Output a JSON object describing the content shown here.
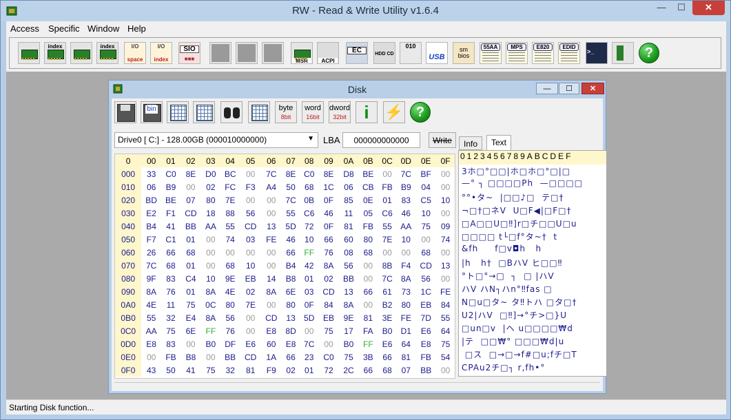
{
  "app": {
    "title": "RW - Read & Write Utility v1.6.4",
    "min_label": "—",
    "max_label": "☐",
    "close_label": "✕"
  },
  "menu": [
    "Access",
    "Specific",
    "Window",
    "Help"
  ],
  "toolbar": {
    "labels": {
      "index1": "index",
      "index2": "index",
      "space": "space",
      "index3": "index",
      "sio": "SIO",
      "msr": "MSR",
      "acpi": "ACPI",
      "ec": "EC",
      "hddcd": "HDD CD",
      "o10": "010",
      "usb": "USB",
      "smbios": "sm bios",
      "aa55": "55AA",
      "mps": "MPS",
      "e820": "E820",
      "edid": "EDID",
      "help": "?"
    }
  },
  "status": "Starting Disk function...",
  "disk": {
    "title": "Disk",
    "tools": {
      "byte_top": "byte",
      "byte_bot": "8",
      "byte_unit": "bit",
      "word_top": "word",
      "word_bot": "16",
      "word_unit": "bit",
      "dword_top": "dword",
      "dword_bot": "32",
      "dword_unit": "bit",
      "info_glyph": "i",
      "help_glyph": "?"
    },
    "drive_select": "Drive0 [ C:] - 128.00GB (000010000000)",
    "lba_label": "LBA",
    "lba_value": "000000000000",
    "write_button": "Write",
    "tabs": [
      "Info",
      "Text"
    ],
    "active_tab": "Text",
    "hex_header": [
      "0",
      "00",
      "01",
      "02",
      "03",
      "04",
      "05",
      "06",
      "07",
      "08",
      "09",
      "0A",
      "0B",
      "0C",
      "0D",
      "0E",
      "0F"
    ],
    "hex_rows": [
      [
        "000",
        "33",
        "C0",
        "8E",
        "D0",
        "BC",
        "00",
        "7C",
        "8E",
        "C0",
        "8E",
        "D8",
        "BE",
        "00",
        "7C",
        "BF",
        "00"
      ],
      [
        "010",
        "06",
        "B9",
        "00",
        "02",
        "FC",
        "F3",
        "A4",
        "50",
        "68",
        "1C",
        "06",
        "CB",
        "FB",
        "B9",
        "04",
        "00"
      ],
      [
        "020",
        "BD",
        "BE",
        "07",
        "80",
        "7E",
        "00",
        "00",
        "7C",
        "0B",
        "0F",
        "85",
        "0E",
        "01",
        "83",
        "C5",
        "10"
      ],
      [
        "030",
        "E2",
        "F1",
        "CD",
        "18",
        "88",
        "56",
        "00",
        "55",
        "C6",
        "46",
        "11",
        "05",
        "C6",
        "46",
        "10",
        "00"
      ],
      [
        "040",
        "B4",
        "41",
        "BB",
        "AA",
        "55",
        "CD",
        "13",
        "5D",
        "72",
        "0F",
        "81",
        "FB",
        "55",
        "AA",
        "75",
        "09"
      ],
      [
        "050",
        "F7",
        "C1",
        "01",
        "00",
        "74",
        "03",
        "FE",
        "46",
        "10",
        "66",
        "60",
        "80",
        "7E",
        "10",
        "00",
        "74"
      ],
      [
        "060",
        "26",
        "66",
        "68",
        "00",
        "00",
        "00",
        "00",
        "66",
        "FF",
        "76",
        "08",
        "68",
        "00",
        "00",
        "68",
        "00"
      ],
      [
        "070",
        "7C",
        "68",
        "01",
        "00",
        "68",
        "10",
        "00",
        "B4",
        "42",
        "8A",
        "56",
        "00",
        "8B",
        "F4",
        "CD",
        "13"
      ],
      [
        "080",
        "9F",
        "83",
        "C4",
        "10",
        "9E",
        "EB",
        "14",
        "B8",
        "01",
        "02",
        "BB",
        "00",
        "7C",
        "8A",
        "56",
        "00"
      ],
      [
        "090",
        "8A",
        "76",
        "01",
        "8A",
        "4E",
        "02",
        "8A",
        "6E",
        "03",
        "CD",
        "13",
        "66",
        "61",
        "73",
        "1C",
        "FE"
      ],
      [
        "0A0",
        "4E",
        "11",
        "75",
        "0C",
        "80",
        "7E",
        "00",
        "80",
        "0F",
        "84",
        "8A",
        "00",
        "B2",
        "80",
        "EB",
        "84"
      ],
      [
        "0B0",
        "55",
        "32",
        "E4",
        "8A",
        "56",
        "00",
        "CD",
        "13",
        "5D",
        "EB",
        "9E",
        "81",
        "3E",
        "FE",
        "7D",
        "55"
      ],
      [
        "0C0",
        "AA",
        "75",
        "6E",
        "FF",
        "76",
        "00",
        "E8",
        "8D",
        "00",
        "75",
        "17",
        "FA",
        "B0",
        "D1",
        "E6",
        "64"
      ],
      [
        "0D0",
        "E8",
        "83",
        "00",
        "B0",
        "DF",
        "E6",
        "60",
        "E8",
        "7C",
        "00",
        "B0",
        "FF",
        "E6",
        "64",
        "E8",
        "75"
      ],
      [
        "0E0",
        "00",
        "FB",
        "B8",
        "00",
        "BB",
        "CD",
        "1A",
        "66",
        "23",
        "C0",
        "75",
        "3B",
        "66",
        "81",
        "FB",
        "54"
      ],
      [
        "0F0",
        "43",
        "50",
        "41",
        "75",
        "32",
        "81",
        "F9",
        "02",
        "01",
        "72",
        "2C",
        "66",
        "68",
        "07",
        "BB",
        "00"
      ]
    ],
    "text_header": "0123456789ABCDEF",
    "text_rows": [
      "3ホ□°□□|ホ□ホ□°□|□",
      "—° ┐ □□□□Ph  —□□□□",
      "°°•タ~  |□□♪□  テ□†",
      "¬□†□ネV  U□F◀|□F□†",
      "□A□□U□‼]r□チ□□U□u",
      "□□□□ t└□f°タ~†  t",
      "&fh     f□v◘h   h",
      "|h   h†  □BハV ヒ□□‼",
      "°ト□°→□  ┐  □ |ハV",
      "ハV ハN┐ハn°‼fas □",
      "N□u□タ~ タ‼トハ □タ□†",
      "U2|ハV  □‼]→°チ>□}U",
      "□un□v  |ヘ u□□□□₩d",
      "|テ  □□₩° □□□₩d|u",
      " □ス  □→□→f#□u;fチ□T",
      "CPAu2チ□┐ r,fh•°"
    ]
  }
}
